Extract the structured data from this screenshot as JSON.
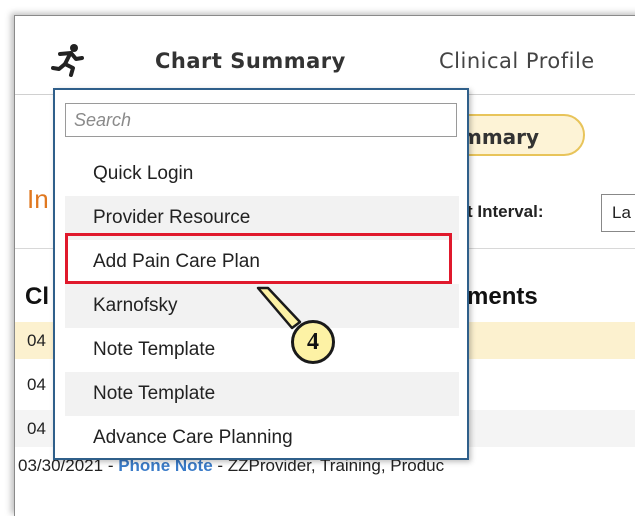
{
  "header": {
    "app_icon": "running-person-icon",
    "tabs": [
      {
        "label": "Chart Summary"
      },
      {
        "label": "Clinical Profile"
      }
    ]
  },
  "summary_pill": {
    "label": "mmary"
  },
  "section": {
    "heading_fragment": "In"
  },
  "interval": {
    "label": "t Interval:",
    "value": "La"
  },
  "notes": {
    "heading_left": "Cl",
    "heading_right": "ments",
    "rows": [
      {
        "date": "04"
      },
      {
        "date": "04"
      },
      {
        "date": "04"
      }
    ],
    "last_row": {
      "date": "03/30/2021",
      "sep1": " - ",
      "type": "Phone Note",
      "sep2": " - ",
      "detail": "ZZProvider, Training, Produc"
    }
  },
  "dropdown": {
    "search_placeholder": "Search",
    "items": [
      {
        "label": "Quick Login"
      },
      {
        "label": "Provider Resource"
      },
      {
        "label": "Add Pain Care Plan"
      },
      {
        "label": "Karnofsky"
      },
      {
        "label": "Note Template"
      },
      {
        "label": "Note Template"
      },
      {
        "label": "Advance Care Planning"
      }
    ]
  },
  "callout": {
    "number": "4",
    "highlight_color": "#e0192c",
    "badge_fill": "#fdf2a5"
  },
  "colors": {
    "dropdown_border": "#2f5f8a",
    "row_highlight": "#fcf1cf",
    "link": "#3a7bc8",
    "heading_orange": "#e07820"
  }
}
